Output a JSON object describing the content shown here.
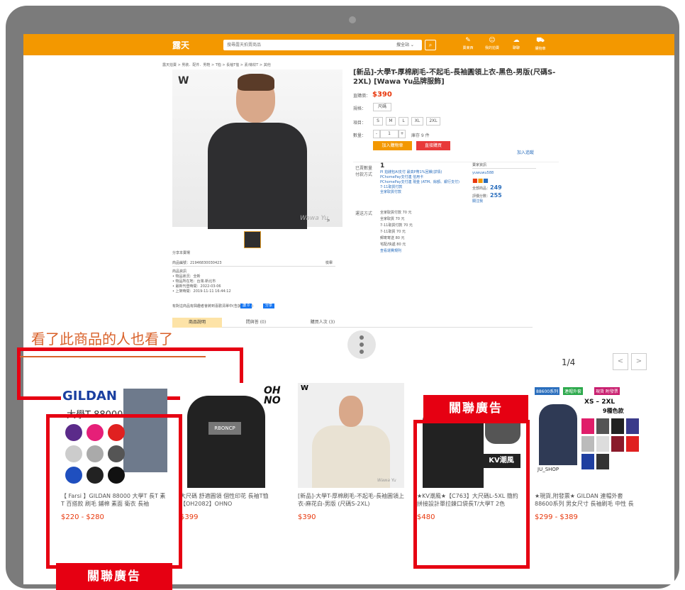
{
  "header": {
    "logo": "露天",
    "search_placeholder": "搜尋露天拍賣商品",
    "scope": "搜全站 ⌄",
    "icons": [
      {
        "name": "賣東西"
      },
      {
        "name": "我的拍賣"
      },
      {
        "name": "聊聊"
      },
      {
        "name": "購物車"
      }
    ]
  },
  "breadcrumb": "露天拍賣 > 男裝．配件．男鞋 > T恤 > 長袖T恤 > 素/條紋T > 其他",
  "brand_mark": "W",
  "watermark": "Wawa Yu",
  "product": {
    "title": "[新品]-大學T-厚棉刷毛-不起毛-長袖圓領上衣-黑色-男版(尺碼S-2XL) [Wawa Yu品牌服飾]",
    "price_label": "直購價：",
    "price": "$390",
    "spec_label": "規格：",
    "spec_value": "尺碼",
    "item_label": "項目：",
    "sizes": [
      "S",
      "M",
      "L",
      "XL",
      "2XL"
    ],
    "qty_label": "數量：",
    "qty": "1",
    "stock": "庫存 9 件",
    "add_cart": "加入購物車",
    "buy_now": "直接購買",
    "track": "加入追蹤",
    "sold_label": "已賣數量",
    "sold": "1",
    "pay_label": "付款方式",
    "payments": [
      "PI 拍錢包AI支付 最高P幣1%回饋(詳情)",
      "PChomePay支付連 信用卡",
      "PChomePay支付連 現金 (ATM、餘額、銀行支付)",
      "7-11取貨付款",
      "全家取貨付款"
    ],
    "ship_label": "運送方式",
    "shipping": [
      "全家取貨付款 70 元",
      "全家取貨 70 元",
      "7-11取貨付款 70 元",
      "7-11取貨 70 元",
      "郵寄寄送 80 元",
      "宅配/快遞 80 元",
      "查看運費規則"
    ],
    "seller_title": "賣家資訊",
    "seller_name": "yuwuwu588",
    "seller_score_label": "全部商品：",
    "seller_score": "249",
    "rating_label": "評價分數：",
    "rating": "255",
    "follow": "關注我"
  },
  "share": "分享本賣場",
  "item_no_label": "商品編號：21946830030423",
  "report": "檢舉",
  "item_info": [
    "商品資訊",
    "• 物品狀況：全新",
    "• 物品所在地：台灣.新北市",
    "• 最新刊登時間：2022-03-06",
    "• 上架時間：2019-11-11 16:44:12"
  ],
  "like_text": "有對這商品有興趣者會將到喜歡清單中(告訴更多人)",
  "like_btn": "讚 0",
  "share_btn": "分享",
  "tabs": [
    "商品說明",
    "問與答 (0)",
    "購買人次 (3)"
  ],
  "related_title": "看了此商品的人也看了",
  "pager": "1/4",
  "ad_label": "關聯廣告",
  "ad_label_2": "關聯廣告",
  "cards": [
    {
      "name": "【 Farsi 】GILDAN 88000 大學T 長T 素T 百搭款 刷毛 鋪棉 素面 衛衣 長袖",
      "price": "$220 - $280",
      "img_text1": "GILDAN",
      "img_text2": "大學T 88000"
    },
    {
      "name": "大尺碼 舒適圓領 個性印花 長袖T恤【OH2082】OHNO",
      "price": "$399",
      "img_text1": "OH NO",
      "img_text2": "RBONCP"
    },
    {
      "name": "[新品]-大學T-厚棉刷毛-不起毛-長袖圓領上衣-麻花白-男版 (尺碼S-2XL)",
      "price": "$390",
      "img_text1": "W",
      "img_text2": "Wawa Yu"
    },
    {
      "name": "★KV潮風★【C763】大尺碼L-5XL 簡約拼接設計單拉鍊口袋長T/大學T 2色",
      "price": "$480",
      "img_text1": "KV潮風",
      "img_text2": ""
    },
    {
      "name": "★現貨,附發票★ GILDAN 連帽外套 88600系列 男女尺寸 長袖刷毛 中性 長",
      "price": "$299 - $389",
      "img_text1": "88600系列",
      "img_text2": "XS – 2XL",
      "img_text3": "9種色款",
      "img_text4": "JU_SHOP",
      "img_text5": "連帽外套",
      "img_text6": "現貨 附發票"
    }
  ]
}
